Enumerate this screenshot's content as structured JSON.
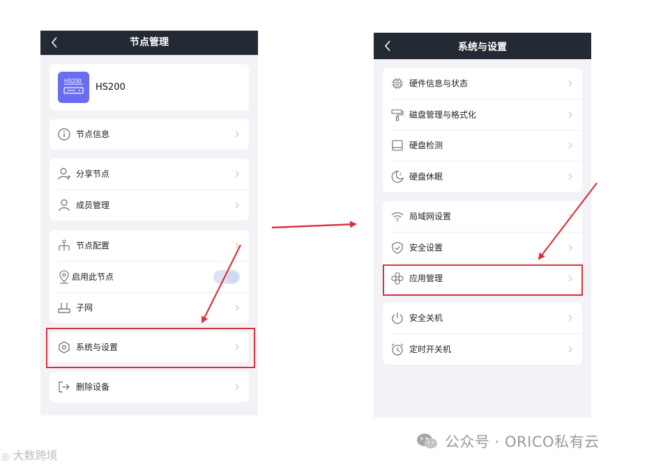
{
  "left_screen": {
    "title": "节点管理",
    "device_name": "HS200",
    "device_badge": "HS200",
    "items": {
      "node_info": "节点信息",
      "share_node": "分享节点",
      "member_mgmt": "成员管理",
      "node_config": "节点配置",
      "enable_node": "启用此节点",
      "subnet": "子网",
      "system_settings": "系统与设置",
      "delete_device": "删除设备"
    },
    "enable_node_toggle": "on"
  },
  "right_screen": {
    "title": "系统与设置",
    "items": {
      "hardware": "硬件信息与状态",
      "disk_mgmt": "磁盘管理与格式化",
      "disk_check": "硬盘检测",
      "disk_sleep": "硬盘休眠",
      "lan": "局域网设置",
      "security": "安全设置",
      "app_mgmt": "应用管理",
      "shutdown": "安全关机",
      "scheduled_power": "定时开关机"
    }
  },
  "watermarks": {
    "right": "公众号 · ORICO私有云",
    "left": "大数跨境"
  },
  "colors": {
    "navbar": "#232a33",
    "page_bg": "#f2f2f7",
    "highlight": "#d9323b",
    "device_icon": "#6b6df0"
  }
}
